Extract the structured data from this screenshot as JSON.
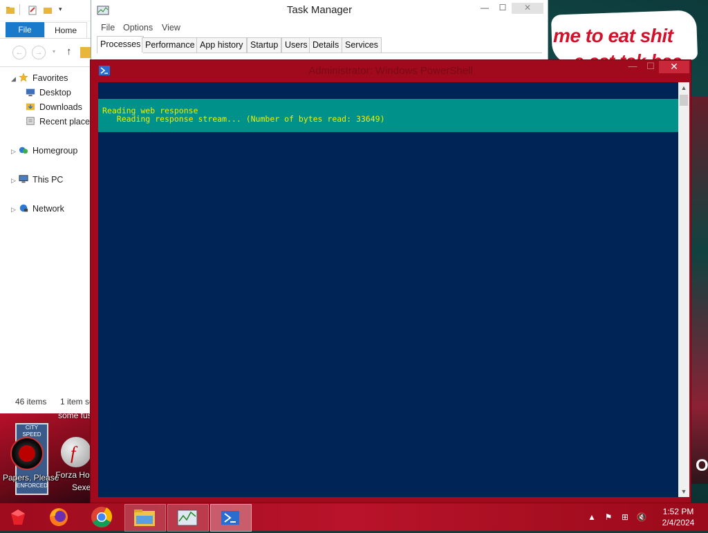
{
  "wallpaper": {
    "meme_line1": "me to eat shit",
    "meme_line2": "e cat tak bac",
    "corner_text": "OS"
  },
  "desktop_icons": [
    {
      "label": "Papers, Please",
      "icon": "papers-please-icon"
    },
    {
      "label": "Forza Ho...",
      "icon": "flash-icon"
    }
  ],
  "desktop_text": {
    "top_label": "some fus",
    "bottom_label": "Sexe",
    "sign_line1": "CITY",
    "sign_line2": "SPEED",
    "sign_line3": "ENFORCED"
  },
  "explorer": {
    "tabs": {
      "file": "File",
      "home": "Home"
    },
    "nav": [
      {
        "label": "Favorites",
        "icon": "star-icon",
        "expanded": true
      },
      {
        "label": "Desktop",
        "icon": "desktop-folder-icon"
      },
      {
        "label": "Downloads",
        "icon": "downloads-folder-icon"
      },
      {
        "label": "Recent places",
        "icon": "recent-places-icon"
      },
      {
        "label": "Homegroup",
        "icon": "homegroup-icon"
      },
      {
        "label": "This PC",
        "icon": "computer-icon"
      },
      {
        "label": "Network",
        "icon": "network-icon"
      }
    ],
    "status": {
      "items": "46 items",
      "selected": "1 item se"
    }
  },
  "taskmanager": {
    "title": "Task Manager",
    "menu": [
      "File",
      "Options",
      "View"
    ],
    "tabs": [
      "Processes",
      "Performance",
      "App history",
      "Startup",
      "Users",
      "Details",
      "Services"
    ],
    "active_tab": "Processes"
  },
  "powershell": {
    "title": "Administrator: Windows PowerShell",
    "progress_line1": "Reading web response",
    "progress_line2": "   Reading response stream... (Number of bytes read: 33649)",
    "colors": {
      "console_bg": "#012456",
      "progress_bg": "#00918a",
      "text": "#f0f000"
    }
  },
  "taskbar": {
    "pinned": [
      "ruby-icon",
      "firefox-icon",
      "chrome-icon",
      "file-explorer-icon",
      "task-manager-icon",
      "powershell-icon"
    ],
    "clock_time": "1:52 PM",
    "clock_date": "2/4/2024",
    "accent": "#b8132a"
  }
}
